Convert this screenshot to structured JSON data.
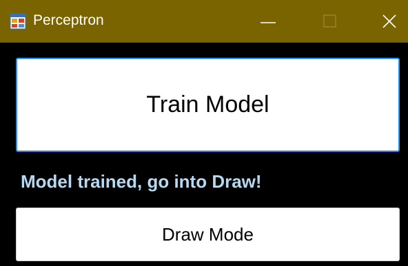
{
  "window": {
    "title": "Perceptron",
    "titlebar_color": "#7a6400",
    "app_icon": "app-form-icon",
    "controls": {
      "minimize_icon": "minimize-icon",
      "maximize_icon": "maximize-icon",
      "close_icon": "close-icon"
    }
  },
  "main": {
    "train_button_label": "Train Model",
    "status_text": "Model trained, go into Draw!",
    "status_color": "#b6d8f0",
    "draw_button_label": "Draw Mode",
    "focus_color": "#1e90ff"
  }
}
